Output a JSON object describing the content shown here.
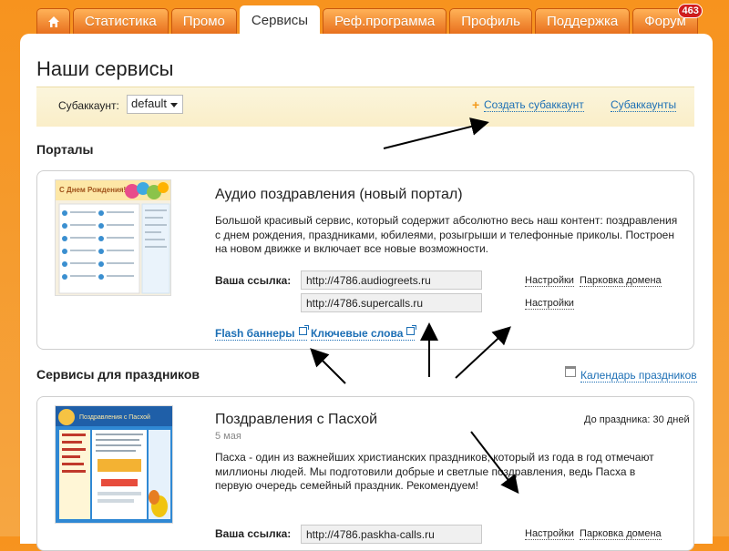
{
  "tabs": {
    "home_icon": "home-icon",
    "items": [
      "Статистика",
      "Промо",
      "Сервисы",
      "Реф.программа",
      "Профиль",
      "Поддержка",
      "Форум"
    ],
    "active": "Сервисы",
    "forum_badge": "463"
  },
  "page": {
    "title": "Наши сервисы"
  },
  "toolbar": {
    "subaccount_label": "Субаккаунт:",
    "subaccount_value": "default",
    "create_link": "Создать субаккаунт",
    "subaccounts_link": "Субаккаунты"
  },
  "portals": {
    "section_title": "Порталы",
    "card": {
      "thumb_caption": "С Днем Рождения!",
      "title": "Аудио поздравления (новый портал)",
      "description": "Большой красивый сервис, который содержит абсолютно весь наш контент: поздравления с днем рождения, праздниками, юбилеями, розыгрыши и телефонные приколы. Построен на новом движке и включает все новые возможности.",
      "link_label": "Ваша ссылка:",
      "urls": [
        {
          "value": "http://4786.audiogreets.ru",
          "settings": "Настройки",
          "parking": "Парковка домена"
        },
        {
          "value": "http://4786.supercalls.ru",
          "settings": "Настройки"
        }
      ],
      "flash_banners": "Flash баннеры",
      "keywords": "Ключевые слова"
    }
  },
  "holidays": {
    "section_title": "Сервисы для праздников",
    "calendar_link": "Календарь праздников",
    "card": {
      "thumb_caption": "Поздравления с Пасхой",
      "title": "Поздравления с Пасхой",
      "date": "5 мая",
      "days_left": "До праздника: 30 дней",
      "description": "Пасха - один из важнейших христианских праздников, который из года в год отмечают миллионы людей. Мы подготовили добрые и светлые поздравления, ведь Пасха в первую очередь семейный праздник. Рекомендуем!",
      "link_label": "Ваша ссылка:",
      "url": "http://4786.paskha-calls.ru",
      "settings": "Настройки",
      "parking": "Парковка домена"
    }
  },
  "colors": {
    "orange": "#f7931e",
    "link_blue": "#1c6fb5",
    "toolbar_bg": "#faeec8"
  }
}
